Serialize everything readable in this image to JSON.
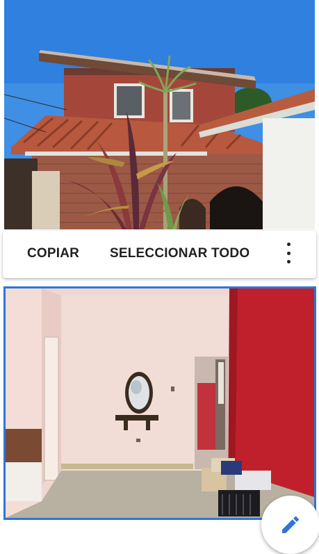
{
  "photos": {
    "exterior": {
      "icon": "house-exterior-photo"
    },
    "interior": {
      "icon": "interior-room-photo",
      "selected": true
    }
  },
  "selection_toolbar": {
    "copy_label": "COPIAR",
    "select_all_label": "SELECCIONAR TODO",
    "more_icon": "more-vert-icon"
  },
  "fab": {
    "icon": "pencil-edit-icon"
  },
  "colors": {
    "selection_border": "#2f74d9",
    "edit_icon": "#2f74d9",
    "toolbar_text": "#212121"
  }
}
